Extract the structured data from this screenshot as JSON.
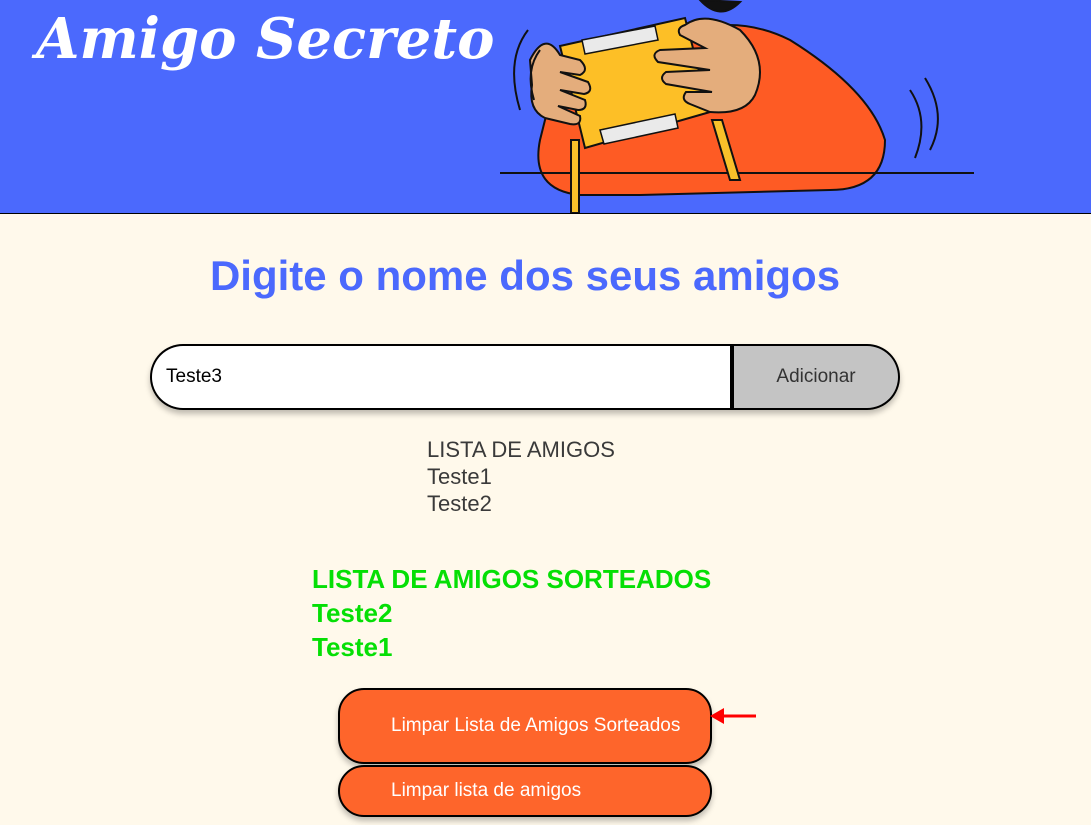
{
  "header": {
    "title": "Amigo Secreto"
  },
  "main": {
    "heading": "Digite o nome dos seus amigos",
    "name_input": {
      "value": "Teste3",
      "placeholder": ""
    },
    "add_button_label": "Adicionar",
    "friends_list": {
      "heading": "LISTA DE AMIGOS",
      "items": [
        "Teste1",
        "Teste2"
      ]
    },
    "drawn_list": {
      "heading": "LISTA DE AMIGOS SORTEADOS",
      "items": [
        "Teste2",
        "Teste1"
      ]
    },
    "clear_drawn_button_label": "Limpar Lista de Amigos Sorteados",
    "clear_friends_button_label": "Limpar lista de amigos"
  },
  "icons": {
    "illustration": "person-holding-gift-box",
    "annotation": "red-arrow-left-icon"
  },
  "colors": {
    "header_bg": "#4B69FD",
    "page_bg": "#FFF9EB",
    "heading": "#4B69FD",
    "drawn_text": "#05DF05",
    "action_button": "#FE652B",
    "add_button": "#C4C4C4",
    "arrow": "#FF0000"
  }
}
